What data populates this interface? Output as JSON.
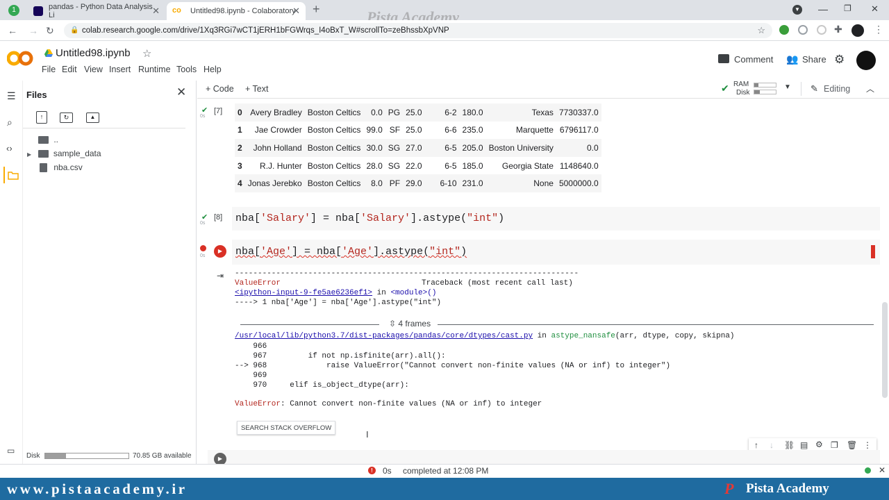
{
  "browser": {
    "tabs": [
      {
        "title": "pandas - Python Data Analysis Li",
        "active": false
      },
      {
        "title": "Untitled98.ipynb - Colaboratory",
        "active": true
      }
    ],
    "url": "colab.research.google.com/drive/1Xq3RGi7wCT1jERH1bFGWrqs_I4oBxT_W#scrollTo=zeBhssbXpVNP",
    "watermark": "Pista Academy"
  },
  "colab": {
    "notebook_title": "Untitled98.ipynb",
    "menu": [
      "File",
      "Edit",
      "View",
      "Insert",
      "Runtime",
      "Tools",
      "Help"
    ],
    "comment_label": "Comment",
    "share_label": "Share",
    "add_code": "+ Code",
    "add_text": "+ Text",
    "ram_label": "RAM",
    "disk_label": "Disk",
    "editing_label": "Editing"
  },
  "files_panel": {
    "title": "Files",
    "items": [
      "..",
      "sample_data",
      "nba.csv"
    ],
    "disk_label": "Disk",
    "disk_available": "70.85 GB available",
    "disk_used_fraction": 0.25
  },
  "cells": {
    "cell7": {
      "exec_count": "[7]",
      "time": "0s",
      "rows": [
        [
          "0",
          "Avery Bradley",
          "Boston Celtics",
          "0.0",
          "PG",
          "25.0",
          "6-2",
          "180.0",
          "Texas",
          "7730337.0"
        ],
        [
          "1",
          "Jae Crowder",
          "Boston Celtics",
          "99.0",
          "SF",
          "25.0",
          "6-6",
          "235.0",
          "Marquette",
          "6796117.0"
        ],
        [
          "2",
          "John Holland",
          "Boston Celtics",
          "30.0",
          "SG",
          "27.0",
          "6-5",
          "205.0",
          "Boston University",
          "0.0"
        ],
        [
          "3",
          "R.J. Hunter",
          "Boston Celtics",
          "28.0",
          "SG",
          "22.0",
          "6-5",
          "185.0",
          "Georgia State",
          "1148640.0"
        ],
        [
          "4",
          "Jonas Jerebko",
          "Boston Celtics",
          "8.0",
          "PF",
          "29.0",
          "6-10",
          "231.0",
          "None",
          "5000000.0"
        ]
      ]
    },
    "cell8": {
      "exec_count": "[8]",
      "time": "0s",
      "code_prefix": "nba[",
      "code_str1": "'Salary'",
      "code_mid": "] = nba[",
      "code_str2": "'Salary'",
      "code_suffix": "].astype(",
      "code_str3": "\"int\"",
      "code_end": ")"
    },
    "cell9": {
      "time": "0s",
      "code_prefix": "nba[",
      "code_str1": "'Age'",
      "code_mid": "] = nba[",
      "code_str2": "'Age'",
      "code_suffix": "].astype(",
      "code_str3": "\"int\"",
      "code_end": ")",
      "tb_dashes": "---------------------------------------------------------------------------",
      "tb_error_name": "ValueError",
      "tb_header_right": "Traceback (most recent call last)",
      "tb_input_link": "<ipython-input-9-fe5ae6236ef1>",
      "tb_in": " in ",
      "tb_module": "<module>()",
      "tb_line1": "----> 1 nba['Age'] = nba['Age'].astype(\"int\")",
      "frames_label": "4 frames",
      "tb_file": "/usr/local/lib/python3.7/dist-packages/pandas/core/dtypes/cast.py",
      "tb_file_in": " in ",
      "tb_func": "astype_nansafe",
      "tb_func_args": "(arr, dtype, copy, skipna)",
      "tb_lines": [
        "    966",
        "    967         if not np.isfinite(arr).all():",
        "--> 968             raise ValueError(\"Cannot convert non-finite values (NA or inf) to integer\")",
        "    969",
        "    970     elif is_object_dtype(arr):"
      ],
      "tb_final_name": "ValueError",
      "tb_final_msg": ": Cannot convert non-finite values (NA or inf) to integer",
      "so_button": "SEARCH STACK OVERFLOW"
    }
  },
  "status": {
    "time": "0s",
    "completed": "completed at 12:08 PM"
  },
  "banner": {
    "url": "www.pistaacademy.ir",
    "brand": "Pista Academy"
  },
  "colors": {
    "colab_orange": "#f9ab00",
    "error_red": "#d93025",
    "ok_green": "#1e8e3e",
    "banner_blue": "#1f6ba0"
  }
}
